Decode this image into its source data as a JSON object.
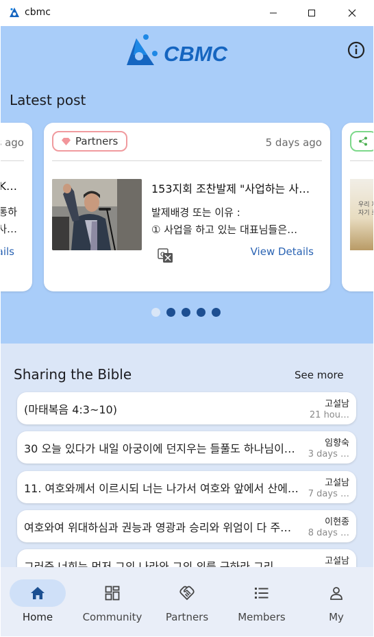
{
  "window": {
    "title": "cbmc",
    "minimize_label": "—",
    "maximize_label": "☐",
    "close_label": "✕"
  },
  "header": {
    "logo_text": "CBMC",
    "info_icon": "info-icon"
  },
  "latest": {
    "title": "Latest post",
    "left_card": {
      "date": "s ago",
      "line1": "K…",
      "line2": "통하",
      "line3": "사…",
      "link": "ails"
    },
    "main_card": {
      "tag": "Partners",
      "date": "5 days ago",
      "title": "153지회 조찬발제 \"사업하는 사…",
      "body_line1": "발제배경 또는 이유 :",
      "body_line2": "① 사업을 하고 있는 대표님들은…",
      "link": "View Details"
    },
    "right_card": {
      "thumb_line1": "우리 재",
      "thumb_line2": "자기 로"
    },
    "pagination": {
      "count": 5,
      "active": 0
    }
  },
  "bible": {
    "title": "Sharing the Bible",
    "see_more": "See more",
    "items": [
      {
        "text": "(마태복음 4:3~10)",
        "author": "고설남",
        "time": "21 hou…"
      },
      {
        "text": "30 오늘 있다가 내일 아궁이에 던지우는 들풀도 하나님이…",
        "author": "임향숙",
        "time": "3 days …"
      },
      {
        "text": "11. 여호와께서 이르시되 너는 나가서 여호와 앞에서 산에…",
        "author": "고설남",
        "time": "7 days …"
      },
      {
        "text": "여호와여 위대하심과 권능과 영광과 승리와 위엄이 다 주…",
        "author": "이현종",
        "time": "8 days …"
      },
      {
        "text": "그러즉 너희는 먼저 그의 나라와 그의 의를 구하라 그리…",
        "author": "고설남",
        "time": ""
      }
    ]
  },
  "nav": {
    "items": [
      {
        "label": "Home",
        "icon": "home-icon",
        "active": true
      },
      {
        "label": "Community",
        "icon": "grid-icon",
        "active": false
      },
      {
        "label": "Partners",
        "icon": "handshake-icon",
        "active": false
      },
      {
        "label": "Members",
        "icon": "list-icon",
        "active": false
      },
      {
        "label": "My",
        "icon": "person-icon",
        "active": false
      }
    ]
  },
  "colors": {
    "hero": "#a9cdf9",
    "background": "#dbe6f7",
    "brand": "#1565c0",
    "accent_link": "#2a63b3",
    "tag_border": "#f09a9e"
  }
}
